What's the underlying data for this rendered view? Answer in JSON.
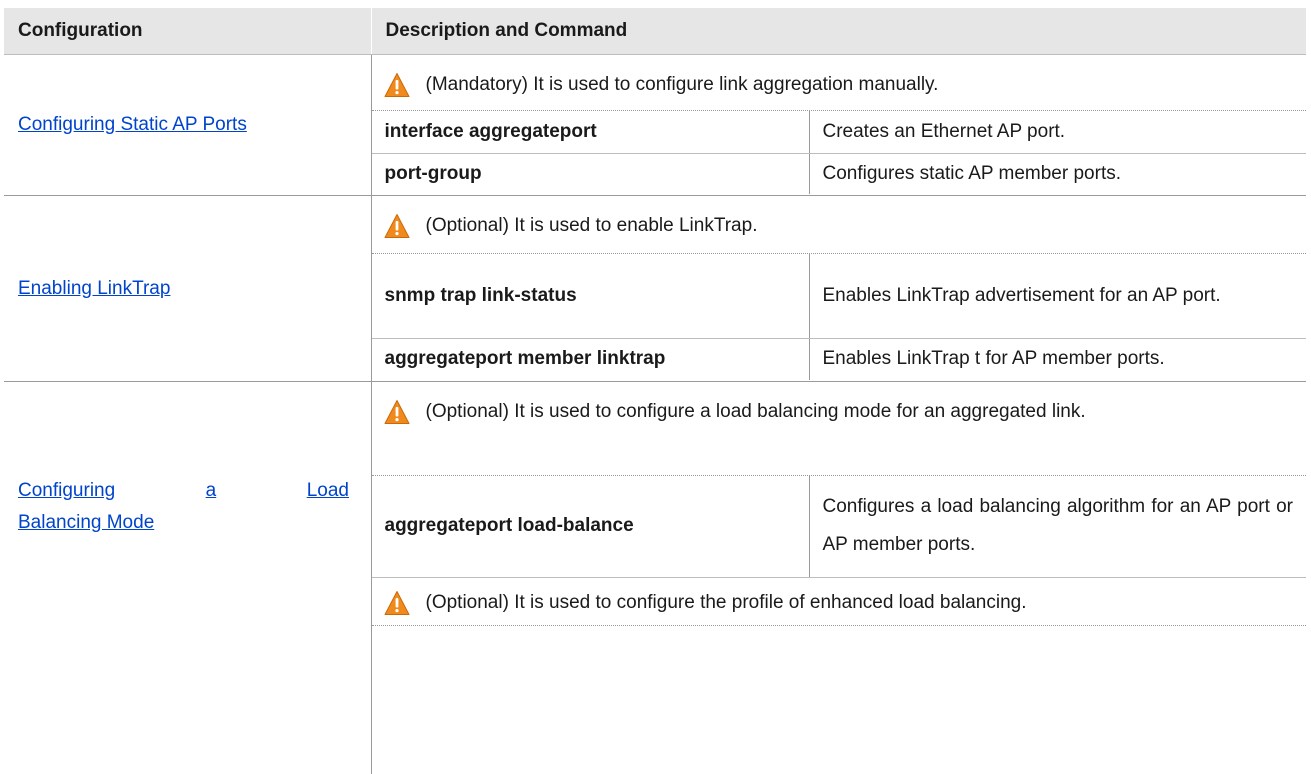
{
  "header": {
    "col1": "Configuration",
    "col2": "Description and Command"
  },
  "rows": [
    {
      "link": "Configuring Static AP Ports",
      "note": "(Mandatory) It is used to configure link aggregation manually.",
      "commands": [
        {
          "cmd": "interface aggregateport",
          "desc": "Creates an Ethernet AP port."
        },
        {
          "cmd": "port-group",
          "desc": "Configures static AP member ports."
        }
      ]
    },
    {
      "link": "Enabling LinkTrap",
      "note": "(Optional) It is used to enable LinkTrap.",
      "commands": [
        {
          "cmd": "snmp trap link-status",
          "desc": "Enables LinkTrap advertisement for an AP port."
        },
        {
          "cmd": "aggregateport member linktrap",
          "desc": "Enables LinkTrap t for AP member ports."
        }
      ]
    },
    {
      "link_words": [
        "Configuring",
        "a",
        "Load"
      ],
      "link_line2": "Balancing Mode",
      "note": "(Optional) It is used to configure a load balancing mode for an aggregated link.",
      "commands": [
        {
          "cmd": "aggregateport load-balance",
          "desc": "Configures a load balancing algorithm for an AP port or AP member ports."
        }
      ],
      "note2": "(Optional) It is used to configure the profile of enhanced load balancing."
    }
  ],
  "icons": {
    "warning": "warning-icon",
    "warning_color": "#f08a1c"
  }
}
